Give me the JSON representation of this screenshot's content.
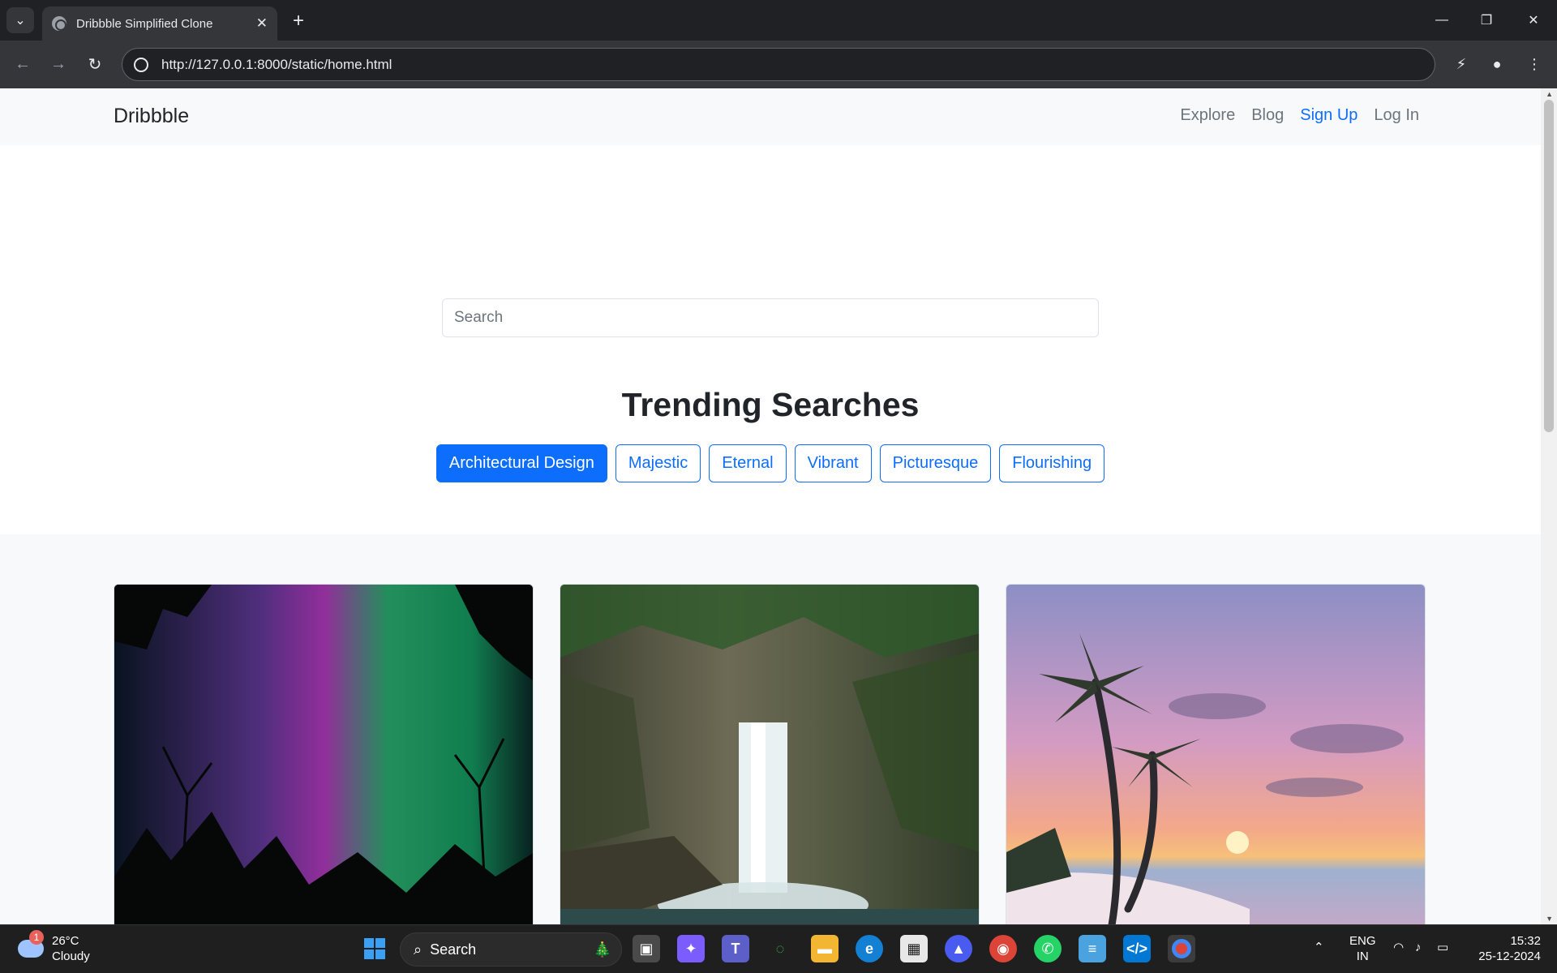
{
  "browser": {
    "tab_title": "Dribbble Simplified Clone",
    "url": "http://127.0.0.1:8000/static/home.html"
  },
  "navbar": {
    "brand": "Dribbble",
    "links": [
      "Explore",
      "Blog",
      "Sign Up",
      "Log In"
    ],
    "active_link": "Sign Up"
  },
  "hero": {
    "search_placeholder": "Search",
    "trending_title": "Trending Searches",
    "tags": [
      "Architectural Design",
      "Majestic",
      "Eternal",
      "Vibrant",
      "Picturesque",
      "Flourishing"
    ],
    "active_tag": "Architectural Design"
  },
  "gallery": {
    "images": [
      "aurora-image",
      "waterfall-image",
      "beach-sunset-image"
    ]
  },
  "taskbar": {
    "weather_badge": "1",
    "temperature": "26°C",
    "condition": "Cloudy",
    "search_label": "Search",
    "language": "ENG",
    "region": "IN",
    "time": "15:32",
    "date": "25-12-2024"
  },
  "colors": {
    "accent": "#0d6efd",
    "navbar_bg": "#f8f9fa",
    "chrome_bg": "#202124"
  }
}
